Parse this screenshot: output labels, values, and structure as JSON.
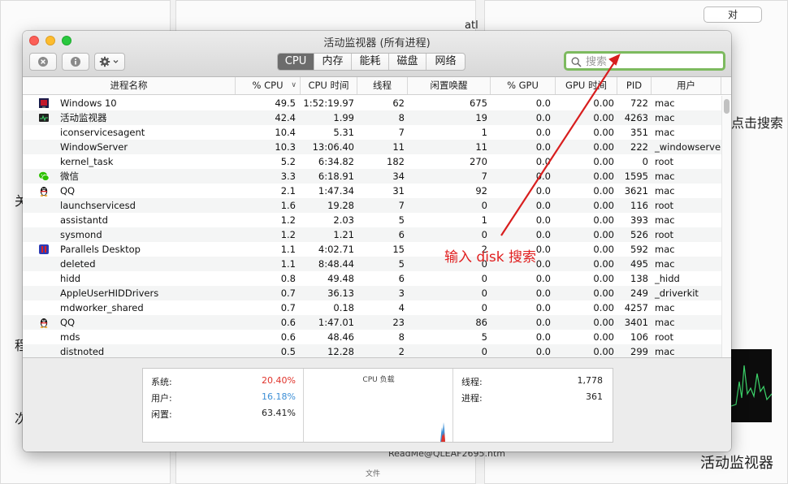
{
  "background": {
    "top_text": "atl",
    "right_text": "点击搜索",
    "left_char_1": "关",
    "left_char_2": "程",
    "left_char_3": "次",
    "bottom_right_text": "活动监视器",
    "button_text": "对",
    "file_text": "ReadMe@QLEAF2695.htm",
    "small_text": "文件"
  },
  "window": {
    "title": "活动监视器 (所有进程)",
    "tabs": [
      "CPU",
      "内存",
      "能耗",
      "磁盘",
      "网络"
    ],
    "active_tab": "CPU",
    "search_placeholder": "搜索"
  },
  "table": {
    "columns": [
      "进程名称",
      "% CPU",
      "CPU 时间",
      "线程",
      "闲置唤醒",
      "% GPU",
      "GPU 时间",
      "PID",
      "用户"
    ],
    "sort_indicator": "∨",
    "rows": [
      {
        "name": "Windows 10",
        "cpu": "49.5",
        "cpu_time": "1:52:19.97",
        "threads": "62",
        "idle_wakeups": "675",
        "gpu": "0.0",
        "gpu_time": "0.00",
        "pid": "722",
        "user": "mac",
        "icon": "parallels-windows-icon"
      },
      {
        "name": "活动监视器",
        "cpu": "42.4",
        "cpu_time": "1.99",
        "threads": "8",
        "idle_wakeups": "19",
        "gpu": "0.0",
        "gpu_time": "0.00",
        "pid": "4263",
        "user": "mac",
        "icon": "activity-monitor-icon"
      },
      {
        "name": "iconservicesagent",
        "cpu": "10.4",
        "cpu_time": "5.31",
        "threads": "7",
        "idle_wakeups": "1",
        "gpu": "0.0",
        "gpu_time": "0.00",
        "pid": "351",
        "user": "mac",
        "icon": ""
      },
      {
        "name": "WindowServer",
        "cpu": "10.3",
        "cpu_time": "13:06.40",
        "threads": "11",
        "idle_wakeups": "11",
        "gpu": "0.0",
        "gpu_time": "0.00",
        "pid": "222",
        "user": "_windowserver",
        "icon": ""
      },
      {
        "name": "kernel_task",
        "cpu": "5.2",
        "cpu_time": "6:34.82",
        "threads": "182",
        "idle_wakeups": "270",
        "gpu": "0.0",
        "gpu_time": "0.00",
        "pid": "0",
        "user": "root",
        "icon": ""
      },
      {
        "name": "微信",
        "cpu": "3.3",
        "cpu_time": "6:18.91",
        "threads": "34",
        "idle_wakeups": "7",
        "gpu": "0.0",
        "gpu_time": "0.00",
        "pid": "1595",
        "user": "mac",
        "icon": "wechat-icon"
      },
      {
        "name": "QQ",
        "cpu": "2.1",
        "cpu_time": "1:47.34",
        "threads": "31",
        "idle_wakeups": "92",
        "gpu": "0.0",
        "gpu_time": "0.00",
        "pid": "3621",
        "user": "mac",
        "icon": "qq-penguin-icon"
      },
      {
        "name": "launchservicesd",
        "cpu": "1.6",
        "cpu_time": "19.28",
        "threads": "7",
        "idle_wakeups": "0",
        "gpu": "0.0",
        "gpu_time": "0.00",
        "pid": "116",
        "user": "root",
        "icon": ""
      },
      {
        "name": "assistantd",
        "cpu": "1.2",
        "cpu_time": "2.03",
        "threads": "5",
        "idle_wakeups": "1",
        "gpu": "0.0",
        "gpu_time": "0.00",
        "pid": "393",
        "user": "mac",
        "icon": ""
      },
      {
        "name": "sysmond",
        "cpu": "1.2",
        "cpu_time": "1.21",
        "threads": "6",
        "idle_wakeups": "0",
        "gpu": "0.0",
        "gpu_time": "0.00",
        "pid": "526",
        "user": "root",
        "icon": ""
      },
      {
        "name": "Parallels Desktop",
        "cpu": "1.1",
        "cpu_time": "4:02.71",
        "threads": "15",
        "idle_wakeups": "2",
        "gpu": "0.0",
        "gpu_time": "0.00",
        "pid": "592",
        "user": "mac",
        "icon": "parallels-desktop-icon"
      },
      {
        "name": "deleted",
        "cpu": "1.1",
        "cpu_time": "8:48.44",
        "threads": "5",
        "idle_wakeups": "0",
        "gpu": "0.0",
        "gpu_time": "0.00",
        "pid": "495",
        "user": "mac",
        "icon": ""
      },
      {
        "name": "hidd",
        "cpu": "0.8",
        "cpu_time": "49.48",
        "threads": "6",
        "idle_wakeups": "0",
        "gpu": "0.0",
        "gpu_time": "0.00",
        "pid": "138",
        "user": "_hidd",
        "icon": ""
      },
      {
        "name": "AppleUserHIDDrivers",
        "cpu": "0.7",
        "cpu_time": "36.13",
        "threads": "3",
        "idle_wakeups": "0",
        "gpu": "0.0",
        "gpu_time": "0.00",
        "pid": "249",
        "user": "_driverkit",
        "icon": ""
      },
      {
        "name": "mdworker_shared",
        "cpu": "0.7",
        "cpu_time": "0.18",
        "threads": "4",
        "idle_wakeups": "0",
        "gpu": "0.0",
        "gpu_time": "0.00",
        "pid": "4257",
        "user": "mac",
        "icon": ""
      },
      {
        "name": "QQ",
        "cpu": "0.6",
        "cpu_time": "1:47.01",
        "threads": "23",
        "idle_wakeups": "86",
        "gpu": "0.0",
        "gpu_time": "0.00",
        "pid": "3401",
        "user": "mac",
        "icon": "qq-penguin-icon"
      },
      {
        "name": "mds",
        "cpu": "0.6",
        "cpu_time": "48.46",
        "threads": "8",
        "idle_wakeups": "5",
        "gpu": "0.0",
        "gpu_time": "0.00",
        "pid": "106",
        "user": "root",
        "icon": ""
      },
      {
        "name": "distnoted",
        "cpu": "0.5",
        "cpu_time": "12.28",
        "threads": "2",
        "idle_wakeups": "0",
        "gpu": "0.0",
        "gpu_time": "0.00",
        "pid": "299",
        "user": "mac",
        "icon": ""
      }
    ]
  },
  "summary": {
    "system_label": "系统:",
    "system_value": "20.40%",
    "user_label": "用户:",
    "user_value": "16.18%",
    "idle_label": "闲置:",
    "idle_value": "63.41%",
    "load_title": "CPU 负载",
    "threads_label": "线程:",
    "threads_value": "1,778",
    "processes_label": "进程:",
    "processes_value": "361"
  },
  "annotation": {
    "text": "输入 disk 搜索"
  },
  "colors": {
    "system": "#e0332b",
    "user": "#3d8fd6",
    "annotation": "#e02020",
    "search_highlight": "#7dba5f"
  }
}
